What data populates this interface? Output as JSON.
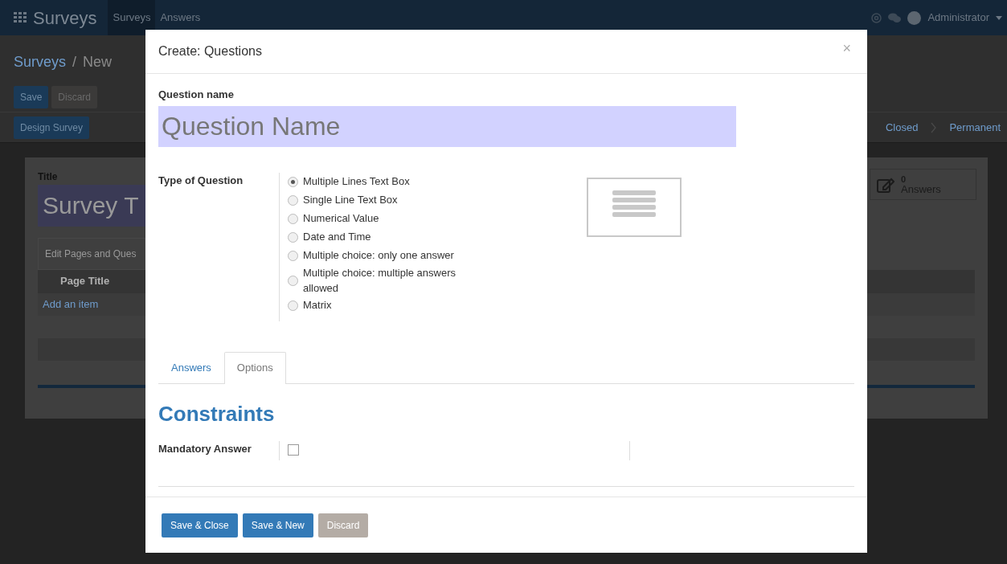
{
  "navbar": {
    "brand": "Surveys",
    "menu": [
      {
        "label": "Surveys",
        "selected": true
      },
      {
        "label": "Answers",
        "selected": false
      }
    ],
    "user": "Administrator"
  },
  "breadcrumb": {
    "items": [
      "Surveys",
      "New"
    ],
    "separator": "/"
  },
  "form_buttons": [
    {
      "label": "Save",
      "kind": "primary"
    },
    {
      "label": "Discard",
      "kind": "secondary"
    }
  ],
  "header_buttons": [
    "Design Survey"
  ],
  "status_stages": [
    "Closed",
    "Permanent"
  ],
  "sheet": {
    "title_label": "Title",
    "title_value": "Survey T",
    "stat_button": {
      "value": "0",
      "label": "Answers"
    },
    "tab": "Edit Pages and Ques",
    "columns": [
      "Page Title"
    ],
    "add_item": "Add an item"
  },
  "dialog": {
    "title": "Create: Questions",
    "close": "×",
    "name_label": "Question name",
    "name_placeholder": "Question Name",
    "type_label": "Type of Question",
    "types": [
      {
        "label": "Multiple Lines Text Box",
        "selected": true
      },
      {
        "label": "Single Line Text Box",
        "selected": false
      },
      {
        "label": "Numerical Value",
        "selected": false
      },
      {
        "label": "Date and Time",
        "selected": false
      },
      {
        "label": "Multiple choice: only one answer",
        "selected": false
      },
      {
        "label": "Multiple choice: multiple answers allowed",
        "selected": false
      },
      {
        "label": "Matrix",
        "selected": false
      }
    ],
    "tabs": [
      {
        "label": "Answers",
        "selected": false
      },
      {
        "label": "Options",
        "selected": true
      }
    ],
    "section_title": "Constraints",
    "fields": [
      {
        "label": "Mandatory Answer",
        "kind": "checkbox",
        "checked": false
      }
    ],
    "buttons": [
      {
        "label": "Save & Close",
        "kind": "primary"
      },
      {
        "label": "Save & New",
        "kind": "primary"
      },
      {
        "label": "Discard",
        "kind": "secondary"
      }
    ]
  }
}
